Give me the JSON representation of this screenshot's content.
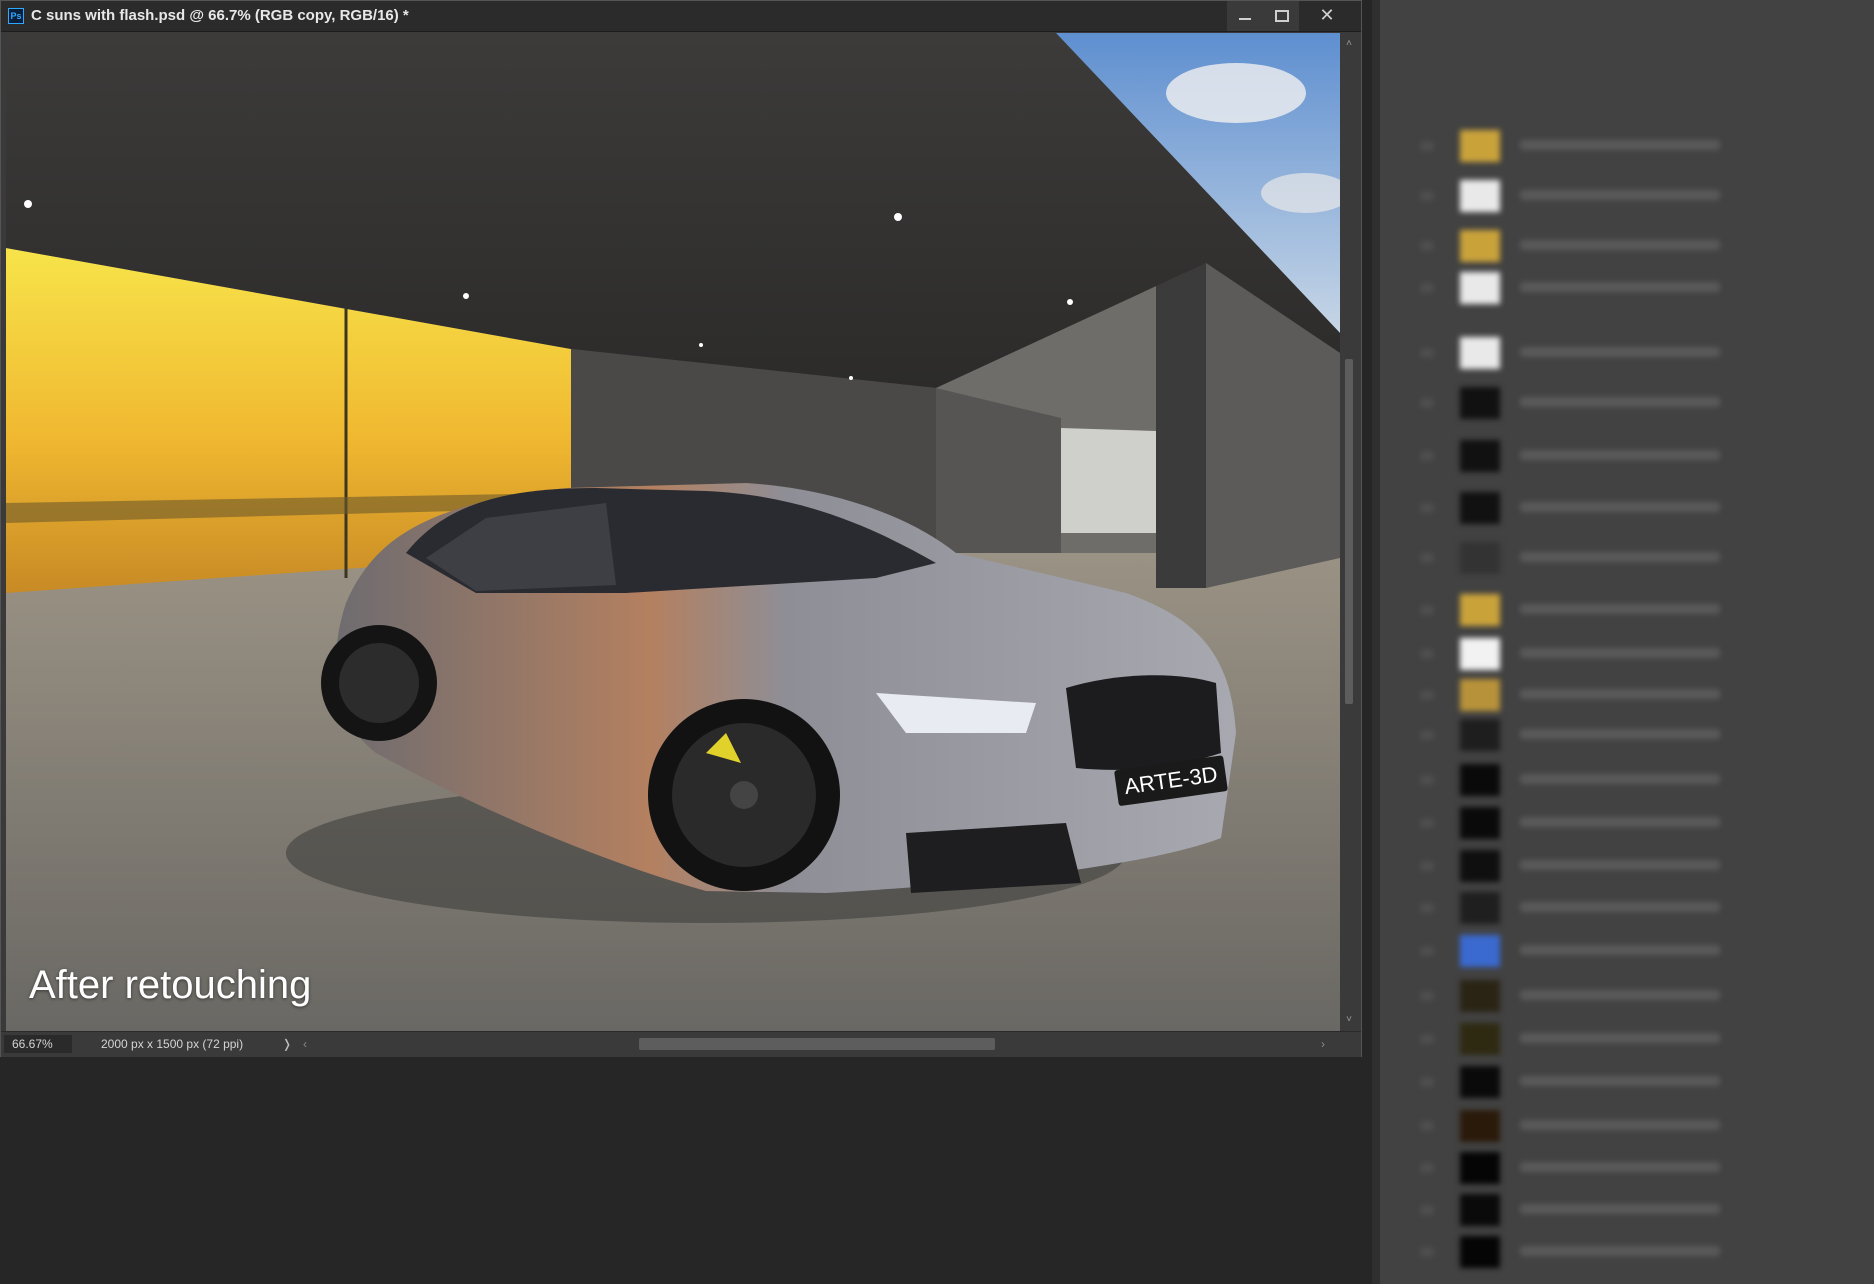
{
  "window": {
    "title": "C suns with flash.psd @ 66.7% (RGB copy, RGB/16) *",
    "app_icon": "Ps",
    "buttons": [
      "minimize-icon",
      "maximize-icon",
      "close-icon"
    ]
  },
  "canvas": {
    "caption": "After retouching",
    "license_plate": "ARTE-3D"
  },
  "status_bar": {
    "zoom": "66.67%",
    "doc_info": "2000 px x 1500 px (72 ppi)",
    "info_arrow": "❭",
    "scroll_left": "‹",
    "scroll_right": "›"
  },
  "scrollbar": {
    "up": "˄",
    "down": "˅"
  },
  "layers_panel": {
    "rows": [
      {
        "thumb_color": "#c9a23a"
      },
      {
        "thumb_color": "#e9e9e9"
      },
      {
        "thumb_color": "#c9a23a"
      },
      {
        "thumb_color": "#e9e9e9"
      },
      {
        "thumb_color": "#e9e9e9"
      },
      {
        "thumb_color": "#111111"
      },
      {
        "thumb_color": "#111111"
      },
      {
        "thumb_color": "#111111"
      },
      {
        "thumb_color": "#333333"
      },
      {
        "thumb_color": "#c9a23a"
      },
      {
        "thumb_color": "#f2f2f2"
      },
      {
        "thumb_color": "#b8923a"
      },
      {
        "thumb_color": "#1e1e1e"
      },
      {
        "thumb_color": "#0a0a0a"
      },
      {
        "thumb_color": "#0a0a0a"
      },
      {
        "thumb_color": "#0f0f0f"
      },
      {
        "thumb_color": "#1f1f1f"
      },
      {
        "thumb_color": "#3a6ad0"
      },
      {
        "thumb_color": "#2a2414"
      },
      {
        "thumb_color": "#2e2a12"
      },
      {
        "thumb_color": "#0a0a0a"
      },
      {
        "thumb_color": "#2a1a0a"
      },
      {
        "thumb_color": "#050505"
      },
      {
        "thumb_color": "#0a0a0a"
      },
      {
        "thumb_color": "#050505"
      }
    ]
  }
}
